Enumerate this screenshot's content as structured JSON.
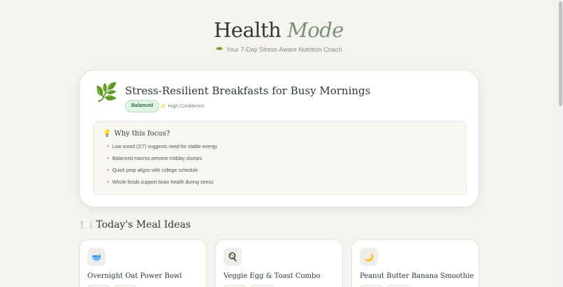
{
  "header": {
    "title_main": "Health",
    "title_accent": "Mode",
    "subtitle_icon": "🥗",
    "subtitle": "Your 7-Day Stress-Aware Nutrition Coach"
  },
  "focus": {
    "icon": "🌿",
    "title": "Stress-Resilient Breakfasts for Busy Mornings",
    "badge": "Balanced",
    "confidence_icon": "✨",
    "confidence": "High Confidence",
    "why_icon": "💡",
    "why_title": "Why this focus?",
    "reasons": [
      "Low mood (2/7) suggests need for stable energy",
      "Balanced macros prevent midday slumps",
      "Quick prep aligns with college schedule",
      "Whole foods support brain health during stress"
    ]
  },
  "meals_section": {
    "icon": "🍽️",
    "title": "Today's Meal Ideas",
    "meals": [
      {
        "icon": "🥣",
        "name": "Overnight Oat Power Bowl"
      },
      {
        "icon": "🍳",
        "name": "Veggie Egg & Toast Combo"
      },
      {
        "icon": "🌙",
        "name": "Peanut Butter Banana Smoothie"
      }
    ]
  },
  "colors": {
    "background": "#f5f3ee",
    "accent": "#7a8f7b",
    "badge_bg": "#dff5e3"
  }
}
